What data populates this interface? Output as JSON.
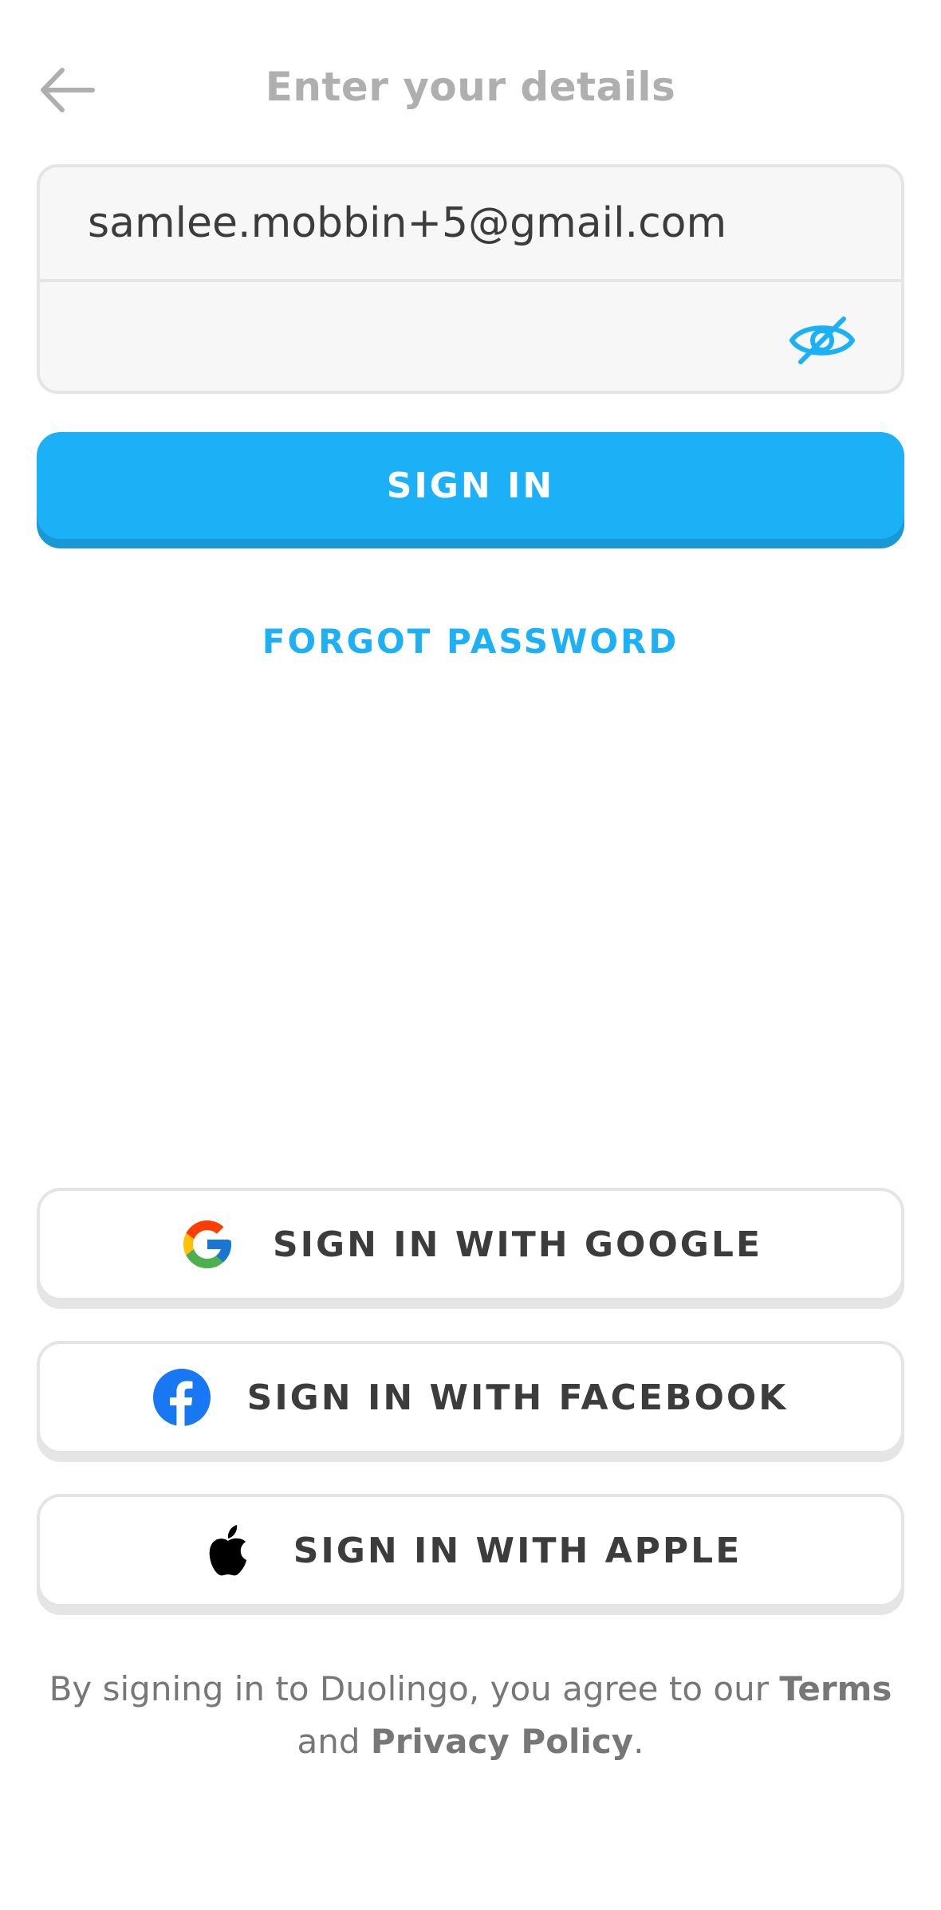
{
  "header": {
    "title": "Enter your details",
    "back_icon": "arrow-left-icon"
  },
  "form": {
    "email_value": "samlee.mobbin+5@gmail.com",
    "password_value": "",
    "toggle_icon": "eye-slash-icon"
  },
  "actions": {
    "sign_in_label": "SIGN IN",
    "forgot_password_label": "FORGOT PASSWORD"
  },
  "social": [
    {
      "label": "SIGN IN WITH GOOGLE",
      "icon": "google-icon"
    },
    {
      "label": "SIGN IN WITH FACEBOOK",
      "icon": "facebook-icon"
    },
    {
      "label": "SIGN IN WITH APPLE",
      "icon": "apple-icon"
    }
  ],
  "legal": {
    "prefix": "By signing in to Duolingo, you agree to our",
    "terms_label": "Terms",
    "middle": "and",
    "privacy_label": "Privacy Policy",
    "suffix": "."
  },
  "colors": {
    "accent": "#1cb0f6",
    "accent_shadow": "#1899d6",
    "border": "#e5e5e5",
    "title_gray": "#afafaf",
    "text_dark": "#3c3c3c"
  }
}
